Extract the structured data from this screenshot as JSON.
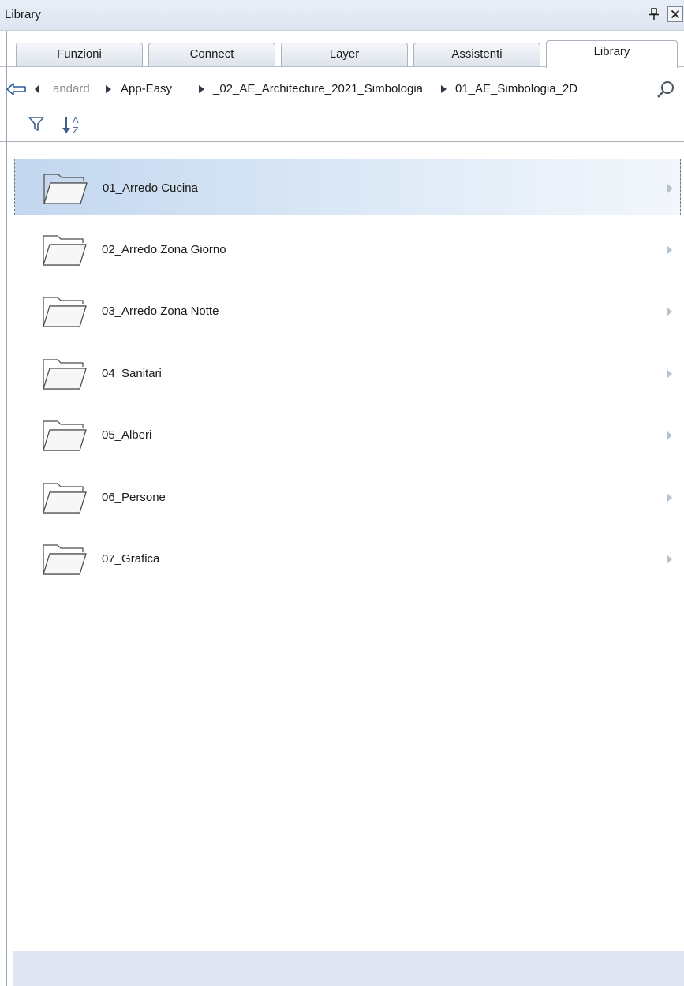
{
  "window": {
    "title": "Library"
  },
  "tabs": [
    {
      "label": "Funzioni",
      "active": false
    },
    {
      "label": "Connect",
      "active": false
    },
    {
      "label": "Layer",
      "active": false
    },
    {
      "label": "Assistenti",
      "active": false
    },
    {
      "label": "Library",
      "active": true
    }
  ],
  "breadcrumb": [
    {
      "label": "andard",
      "dim": true
    },
    {
      "label": "App-Easy",
      "dim": false
    },
    {
      "label": "_02_AE_Architecture_2021_Simbologia",
      "dim": false
    },
    {
      "label": "01_AE_Simbologia_2D",
      "dim": false
    }
  ],
  "toolbar": {
    "filter_icon": "filter-icon",
    "sort_icon": "sort-az-icon"
  },
  "items": [
    {
      "label": "01_Arredo Cucina",
      "selected": true
    },
    {
      "label": "02_Arredo Zona Giorno",
      "selected": false
    },
    {
      "label": "03_Arredo Zona Notte",
      "selected": false
    },
    {
      "label": "04_Sanitari",
      "selected": false
    },
    {
      "label": "05_Alberi",
      "selected": false
    },
    {
      "label": "06_Persone",
      "selected": false
    },
    {
      "label": "07_Grafica",
      "selected": false
    }
  ],
  "colors": {
    "selection": "#c3d7ef",
    "chrome": "#dfe6f1"
  }
}
